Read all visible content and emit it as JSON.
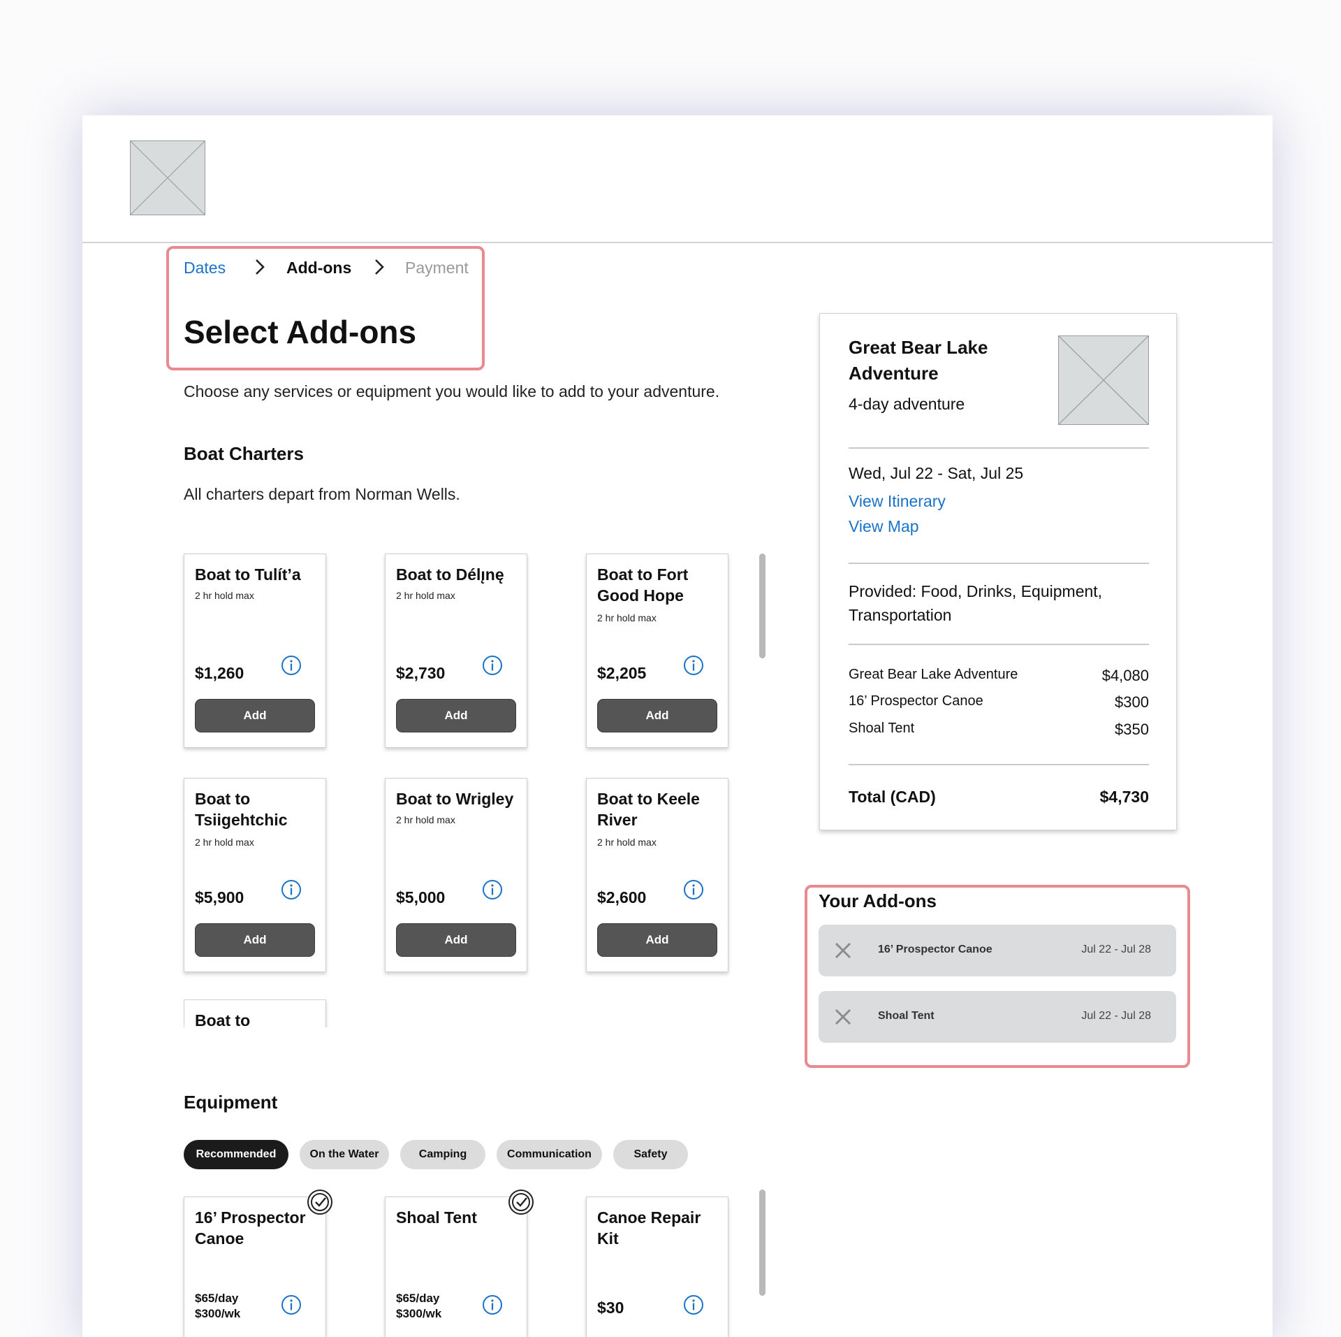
{
  "breadcrumb": {
    "steps": [
      {
        "label": "Dates",
        "state": "link"
      },
      {
        "label": "Add-ons",
        "state": "current"
      },
      {
        "label": "Payment",
        "state": "disabled"
      }
    ]
  },
  "page": {
    "title": "Select Add-ons",
    "intro": "Choose any services or equipment you would like to add to your adventure."
  },
  "boat_charters": {
    "title": "Boat Charters",
    "subtitle": "All charters depart from Norman Wells.",
    "cards": [
      {
        "title": "Boat to Tulít’a",
        "hold": "2 hr hold max",
        "price": "$1,260",
        "button": "Add"
      },
      {
        "title": "Boat to Délı̨nę",
        "hold": "2 hr hold max",
        "price": "$2,730",
        "button": "Add"
      },
      {
        "title": "Boat to Fort Good Hope",
        "hold": "2 hr hold max",
        "price": "$2,205",
        "button": "Add"
      },
      {
        "title": "Boat to Tsiigehtchic",
        "hold": "2 hr hold max",
        "price": "$5,900",
        "button": "Add"
      },
      {
        "title": "Boat to Wrigley",
        "hold": "2 hr hold max",
        "price": "$5,000",
        "button": "Add"
      },
      {
        "title": "Boat to Keele River",
        "hold": "2 hr hold max",
        "price": "$2,600",
        "button": "Add"
      },
      {
        "title": "Boat to"
      }
    ]
  },
  "equipment": {
    "title": "Equipment",
    "filters": [
      {
        "label": "Recommended",
        "active": true
      },
      {
        "label": "On the Water",
        "active": false
      },
      {
        "label": "Camping",
        "active": false
      },
      {
        "label": "Communication",
        "active": false
      },
      {
        "label": "Safety",
        "active": false
      }
    ],
    "cards": [
      {
        "title": "16’ Prospector Canoe",
        "price_day": "$65/day",
        "price_week": "$300/wk",
        "selected": true
      },
      {
        "title": "Shoal Tent",
        "price_day": "$65/day",
        "price_week": "$300/wk",
        "selected": true
      },
      {
        "title": "Canoe Repair Kit",
        "price": "$30",
        "selected": false
      }
    ]
  },
  "summary": {
    "title": "Great Bear Lake Adventure",
    "duration": "4-day adventure",
    "dates": "Wed, Jul 22 - Sat, Jul 25",
    "links": {
      "itinerary": "View Itinerary",
      "map": "View Map"
    },
    "provided": "Provided: Food, Drinks, Equipment, Transportation",
    "line_items": [
      {
        "label": "Great Bear Lake Adventure",
        "amount": "$4,080"
      },
      {
        "label": "16’ Prospector Canoe",
        "amount": "$300"
      },
      {
        "label": "Shoal Tent",
        "amount": "$350"
      }
    ],
    "total_label": "Total (CAD)",
    "total_amount": "$4,730"
  },
  "your_addons": {
    "title": "Your Add-ons",
    "items": [
      {
        "name": "16’ Prospector Canoe",
        "dates": "Jul 22 - Jul 28"
      },
      {
        "name": "Shoal Tent",
        "dates": "Jul 22 - Jul 28"
      }
    ]
  },
  "colors": {
    "link": "#1a73c9",
    "highlight": "#e88a8e",
    "button": "#555555",
    "active_chip": "#1b1b1b",
    "chip": "#dcdcdc"
  },
  "icons": {
    "logo": "image-placeholder-icon",
    "breadcrumb_separator": "chevron-right-icon",
    "info": "info-icon",
    "selected": "check-circle-icon",
    "remove": "close-icon"
  }
}
